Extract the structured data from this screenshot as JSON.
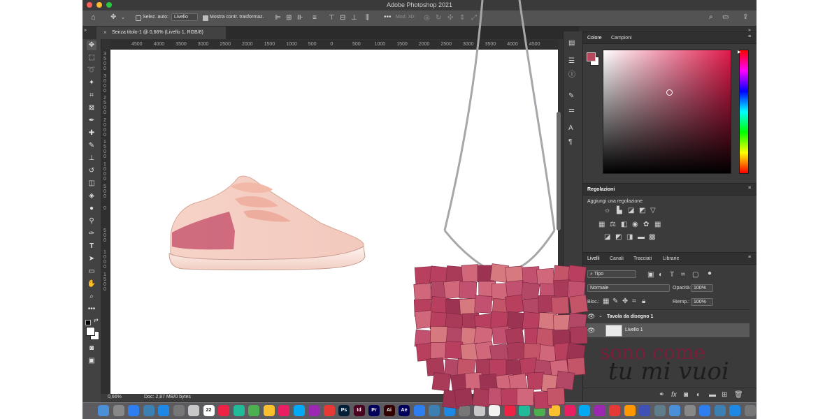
{
  "app": {
    "window_title": "Adobe Photoshop 2021"
  },
  "options_bar": {
    "auto_select_label": "Selez. auto:",
    "auto_select_value": "Livello",
    "show_transform_label": "Mostra contr. trasformaz.",
    "mode_3d_label": "Mod. 3D:",
    "more_icon": "more-icon"
  },
  "document": {
    "tab_title": "Senza titolo-1 @ 0,66% (Livello 1, RGB/8)",
    "ruler_h": [
      "4500",
      "4000",
      "3500",
      "3000",
      "2500",
      "2000",
      "1500",
      "1000",
      "500",
      "0",
      "500",
      "1000",
      "1500",
      "2000",
      "2500",
      "3000",
      "3500",
      "4000",
      "4500"
    ],
    "ruler_v": [
      "3500",
      "3000",
      "2500",
      "2000",
      "1500",
      "1000",
      "500",
      "0",
      "500",
      "1000",
      "1500"
    ]
  },
  "status_bar": {
    "zoom": "0,66%",
    "doc_info": "Doc: 2,87 MB/0 bytes"
  },
  "color_panel": {
    "tabs": [
      "Colore",
      "Campioni"
    ],
    "foreground": "#b7475d",
    "background": "#ffffff",
    "hue_color": "#e01a4b"
  },
  "adjustments_panel": {
    "title": "Regolazioni",
    "subtitle": "Aggiungi una regolazione"
  },
  "layers_panel": {
    "tabs": [
      "Livelli",
      "Canali",
      "Tracciati",
      "Librarie"
    ],
    "filter_kind": "Tipo",
    "blend_mode": "Normale",
    "opacity_label": "Opacità:",
    "opacity_value": "100%",
    "lock_label": "Bloc.:",
    "fill_label": "Riemp.:",
    "fill_value": "100%",
    "artboard_name": "Tavola da disegno 1",
    "layer_name": "Livello 1"
  },
  "overlay": {
    "line1": "sono come",
    "line2": "tu mi vuoi"
  },
  "dock": {
    "illustrator": "Ai",
    "aftereffects": "Ae",
    "premiere": "Pr",
    "indesign": "Id",
    "photoshop": "Ps",
    "calendar_day": "22"
  }
}
